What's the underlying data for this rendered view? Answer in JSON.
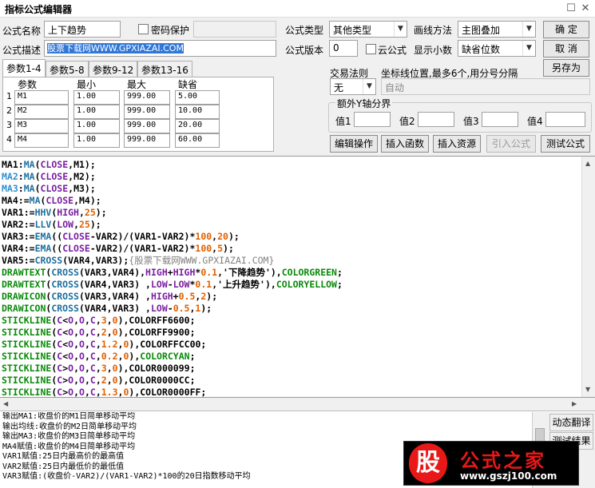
{
  "window": {
    "title": "指标公式编辑器",
    "restore_glyph": "☐",
    "close_glyph": "✕"
  },
  "form": {
    "name_label": "公式名称",
    "name_value": "上下趋势",
    "pwd_label": "密码保护",
    "pwd_value": "",
    "desc_label": "公式描述",
    "desc_value": "股票下载网WWW.GPXIAZAI.COM",
    "type_label": "公式类型",
    "type_value": "其他类型",
    "draw_label": "画线方法",
    "draw_value": "主图叠加",
    "version_label": "公式版本",
    "version_value": "0",
    "cloud_label": "云公式",
    "decimals_label": "显示小数",
    "decimals_value": "缺省位数",
    "trade_label": "交易法则",
    "trade_value": "无",
    "coord_label": "坐标线位置,最多6个,用分号分隔",
    "coord_value": "自动",
    "extra_y_label": "额外Y轴分界",
    "y1_label": "值1",
    "y2_label": "值2",
    "y3_label": "值3",
    "y4_label": "值4"
  },
  "buttons": {
    "ok": "确  定",
    "cancel": "取  消",
    "save_as": "另存为",
    "edit_ops": "编辑操作",
    "insert_func": "插入函数",
    "insert_res": "插入资源",
    "import_formula": "引入公式",
    "test_formula": "测试公式"
  },
  "tabs": [
    "参数1-4",
    "参数5-8",
    "参数9-12",
    "参数13-16"
  ],
  "params": {
    "headers": [
      "参数",
      "最小",
      "最大",
      "缺省"
    ],
    "rows": [
      {
        "n": "1",
        "name": "M1",
        "min": "1.00",
        "max": "999.00",
        "def": "5.00"
      },
      {
        "n": "2",
        "name": "M2",
        "min": "1.00",
        "max": "999.00",
        "def": "10.00"
      },
      {
        "n": "3",
        "name": "M3",
        "min": "1.00",
        "max": "999.00",
        "def": "20.00"
      },
      {
        "n": "4",
        "name": "M4",
        "min": "1.00",
        "max": "999.00",
        "def": "60.00"
      }
    ]
  },
  "code": [
    [
      [
        "MA1",
        ""
      ],
      [
        ":",
        ""
      ],
      [
        "MA",
        "#1d6f9f"
      ],
      [
        "(",
        ""
      ],
      [
        "CLOSE",
        "#7a1fa0"
      ],
      [
        ",M1);",
        ""
      ]
    ],
    [
      [
        "MA2",
        "#2f8fd0"
      ],
      [
        ":",
        ""
      ],
      [
        "MA",
        "#1d6f9f"
      ],
      [
        "(",
        ""
      ],
      [
        "CLOSE",
        "#7a1fa0"
      ],
      [
        ",M2);",
        ""
      ]
    ],
    [
      [
        "MA3",
        "#2f8fd0"
      ],
      [
        ":",
        ""
      ],
      [
        "MA",
        "#1d6f9f"
      ],
      [
        "(",
        ""
      ],
      [
        "CLOSE",
        "#7a1fa0"
      ],
      [
        ",M3);",
        ""
      ]
    ],
    [
      [
        "MA4",
        ""
      ],
      [
        ":=",
        ""
      ],
      [
        "MA",
        "#1d6f9f"
      ],
      [
        "(",
        ""
      ],
      [
        "CLOSE",
        "#7a1fa0"
      ],
      [
        ",M4);",
        ""
      ]
    ],
    [
      [
        "VAR1",
        ""
      ],
      [
        ":=",
        ""
      ],
      [
        "HHV",
        "#1d6f9f"
      ],
      [
        "(",
        ""
      ],
      [
        "HIGH",
        "#7a1fa0"
      ],
      [
        ",",
        ""
      ],
      [
        "25",
        "#e06000"
      ],
      [
        ");",
        ""
      ]
    ],
    [
      [
        "VAR2",
        ""
      ],
      [
        ":=",
        ""
      ],
      [
        "LLV",
        "#1d6f9f"
      ],
      [
        "(",
        ""
      ],
      [
        "LOW",
        "#7a1fa0"
      ],
      [
        ",",
        ""
      ],
      [
        "25",
        "#e06000"
      ],
      [
        ");",
        ""
      ]
    ],
    [
      [
        "VAR3",
        ""
      ],
      [
        ":=",
        ""
      ],
      [
        "EMA",
        "#1d6f9f"
      ],
      [
        "((",
        ""
      ],
      [
        "CLOSE",
        "#7a1fa0"
      ],
      [
        "-VAR2)/(VAR1-VAR2)*",
        ""
      ],
      [
        "100",
        "#e06000"
      ],
      [
        ",",
        ""
      ],
      [
        "20",
        "#e06000"
      ],
      [
        ");",
        ""
      ]
    ],
    [
      [
        "VAR4",
        ""
      ],
      [
        ":=",
        ""
      ],
      [
        "EMA",
        "#1d6f9f"
      ],
      [
        "((",
        ""
      ],
      [
        "CLOSE",
        "#7a1fa0"
      ],
      [
        "-VAR2)/(VAR1-VAR2)*",
        ""
      ],
      [
        "100",
        "#e06000"
      ],
      [
        ",",
        ""
      ],
      [
        "5",
        "#e06000"
      ],
      [
        ");",
        ""
      ]
    ],
    [
      [
        "VAR5",
        ""
      ],
      [
        ":=",
        ""
      ],
      [
        "CROSS",
        "#1d6f9f"
      ],
      [
        "(VAR4,VAR3);",
        ""
      ],
      [
        "{股票下载网WWW.GPXIAZAI.COM}",
        "cmt"
      ]
    ],
    [
      [
        "DRAWTEXT",
        "#0a8a0a"
      ],
      [
        "(",
        ""
      ],
      [
        "CROSS",
        "#1d6f9f"
      ],
      [
        "(VAR3,VAR4),",
        ""
      ],
      [
        "HIGH",
        "#7a1fa0"
      ],
      [
        "+",
        ""
      ],
      [
        "HIGH",
        "#7a1fa0"
      ],
      [
        "*",
        ""
      ],
      [
        "0.1",
        "#e06000"
      ],
      [
        ",'下降趋势'),",
        ""
      ],
      [
        "COLORGREEN",
        "#0a8a0a"
      ],
      [
        ";",
        ""
      ]
    ],
    [
      [
        "DRAWTEXT",
        "#0a8a0a"
      ],
      [
        "(",
        ""
      ],
      [
        "CROSS",
        "#1d6f9f"
      ],
      [
        "(VAR4,VAR3) ,",
        ""
      ],
      [
        "LOW",
        "#7a1fa0"
      ],
      [
        "-",
        ""
      ],
      [
        "LOW",
        "#7a1fa0"
      ],
      [
        "*",
        ""
      ],
      [
        "0.1",
        "#e06000"
      ],
      [
        ",'上升趋势'),",
        ""
      ],
      [
        "COLORYELLOW",
        "#0a8a0a"
      ],
      [
        ";",
        ""
      ]
    ],
    [
      [
        "DRAWICON",
        "#0a8a0a"
      ],
      [
        "(",
        ""
      ],
      [
        "CROSS",
        "#1d6f9f"
      ],
      [
        "(VAR3,VAR4) ,",
        ""
      ],
      [
        "HIGH",
        "#7a1fa0"
      ],
      [
        "+",
        ""
      ],
      [
        "0.5",
        "#e06000"
      ],
      [
        ",",
        ""
      ],
      [
        "2",
        "#e06000"
      ],
      [
        ");",
        ""
      ]
    ],
    [
      [
        "DRAWICON",
        "#0a8a0a"
      ],
      [
        "(",
        ""
      ],
      [
        "CROSS",
        "#1d6f9f"
      ],
      [
        "(VAR4,VAR3) ,",
        ""
      ],
      [
        "LOW",
        "#7a1fa0"
      ],
      [
        "-",
        ""
      ],
      [
        "0.5",
        "#e06000"
      ],
      [
        ",",
        ""
      ],
      [
        "1",
        "#e06000"
      ],
      [
        ");",
        ""
      ]
    ],
    [
      [
        "STICKLINE",
        "#0a8a0a"
      ],
      [
        "(",
        ""
      ],
      [
        "C",
        "#7a1fa0"
      ],
      [
        "<",
        ""
      ],
      [
        "O",
        "#7a1fa0"
      ],
      [
        ",",
        ""
      ],
      [
        "O",
        "#7a1fa0"
      ],
      [
        ",",
        ""
      ],
      [
        "C",
        "#7a1fa0"
      ],
      [
        ",",
        ""
      ],
      [
        "3",
        "#e06000"
      ],
      [
        ",",
        ""
      ],
      [
        "0",
        "#e06000"
      ],
      [
        "),COLORFF6600;",
        ""
      ]
    ],
    [
      [
        "STICKLINE",
        "#0a8a0a"
      ],
      [
        "(",
        ""
      ],
      [
        "C",
        "#7a1fa0"
      ],
      [
        "<",
        ""
      ],
      [
        "O",
        "#7a1fa0"
      ],
      [
        ",",
        ""
      ],
      [
        "O",
        "#7a1fa0"
      ],
      [
        ",",
        ""
      ],
      [
        "C",
        "#7a1fa0"
      ],
      [
        ",",
        ""
      ],
      [
        "2",
        "#e06000"
      ],
      [
        ",",
        ""
      ],
      [
        "0",
        "#e06000"
      ],
      [
        "),COLORFF9900;",
        ""
      ]
    ],
    [
      [
        "STICKLINE",
        "#0a8a0a"
      ],
      [
        "(",
        ""
      ],
      [
        "C",
        "#7a1fa0"
      ],
      [
        "<",
        ""
      ],
      [
        "O",
        "#7a1fa0"
      ],
      [
        ",",
        ""
      ],
      [
        "O",
        "#7a1fa0"
      ],
      [
        ",",
        ""
      ],
      [
        "C",
        "#7a1fa0"
      ],
      [
        ",",
        ""
      ],
      [
        "1.2",
        "#e06000"
      ],
      [
        ",",
        ""
      ],
      [
        "0",
        "#e06000"
      ],
      [
        "),COLORFFCC00;",
        ""
      ]
    ],
    [
      [
        "STICKLINE",
        "#0a8a0a"
      ],
      [
        "(",
        ""
      ],
      [
        "C",
        "#7a1fa0"
      ],
      [
        "<",
        ""
      ],
      [
        "O",
        "#7a1fa0"
      ],
      [
        ",",
        ""
      ],
      [
        "O",
        "#7a1fa0"
      ],
      [
        ",",
        ""
      ],
      [
        "C",
        "#7a1fa0"
      ],
      [
        ",",
        ""
      ],
      [
        "0.2",
        "#e06000"
      ],
      [
        ",",
        ""
      ],
      [
        "0",
        "#e06000"
      ],
      [
        "),",
        ""
      ],
      [
        "COLORCYAN",
        "#0a8a0a"
      ],
      [
        ";",
        ""
      ]
    ],
    [
      [
        "STICKLINE",
        "#0a8a0a"
      ],
      [
        "(",
        ""
      ],
      [
        "C",
        "#7a1fa0"
      ],
      [
        ">",
        ""
      ],
      [
        "O",
        "#7a1fa0"
      ],
      [
        ",",
        ""
      ],
      [
        "O",
        "#7a1fa0"
      ],
      [
        ",",
        ""
      ],
      [
        "C",
        "#7a1fa0"
      ],
      [
        ",",
        ""
      ],
      [
        "3",
        "#e06000"
      ],
      [
        ",",
        ""
      ],
      [
        "0",
        "#e06000"
      ],
      [
        "),COLOR000099;",
        ""
      ]
    ],
    [
      [
        "STICKLINE",
        "#0a8a0a"
      ],
      [
        "(",
        ""
      ],
      [
        "C",
        "#7a1fa0"
      ],
      [
        ">",
        ""
      ],
      [
        "O",
        "#7a1fa0"
      ],
      [
        ",",
        ""
      ],
      [
        "O",
        "#7a1fa0"
      ],
      [
        ",",
        ""
      ],
      [
        "C",
        "#7a1fa0"
      ],
      [
        ",",
        ""
      ],
      [
        "2",
        "#e06000"
      ],
      [
        ",",
        ""
      ],
      [
        "0",
        "#e06000"
      ],
      [
        "),COLOR0000CC;",
        ""
      ]
    ],
    [
      [
        "STICKLINE",
        "#0a8a0a"
      ],
      [
        "(",
        ""
      ],
      [
        "C",
        "#7a1fa0"
      ],
      [
        ">",
        ""
      ],
      [
        "O",
        "#7a1fa0"
      ],
      [
        ",",
        ""
      ],
      [
        "O",
        "#7a1fa0"
      ],
      [
        ",",
        ""
      ],
      [
        "C",
        "#7a1fa0"
      ],
      [
        ",",
        ""
      ],
      [
        "1.3",
        "#e06000"
      ],
      [
        ",",
        ""
      ],
      [
        "0",
        "#e06000"
      ],
      [
        "),COLOR0000FF;",
        ""
      ]
    ]
  ],
  "output": [
    "输出MA1:收盘价的M1日简单移动平均",
    "输出均线:收盘价的M2日简单移动平均",
    "输出MA3:收盘价的M3日简单移动平均",
    "MA4赋值:收盘价的M4日简单移动平均",
    "VAR1赋值:25日内最高价的最高值",
    "VAR2赋值:25日内最低价的最低值",
    "VAR3赋值:(收盘价-VAR2)/(VAR1-VAR2)*100的20日指数移动平均"
  ],
  "side": {
    "translate": "动态翻译",
    "test_result": "测试结果"
  },
  "logo": {
    "char": "股",
    "text": "公式之家",
    "url": "www.gszj100.com"
  }
}
